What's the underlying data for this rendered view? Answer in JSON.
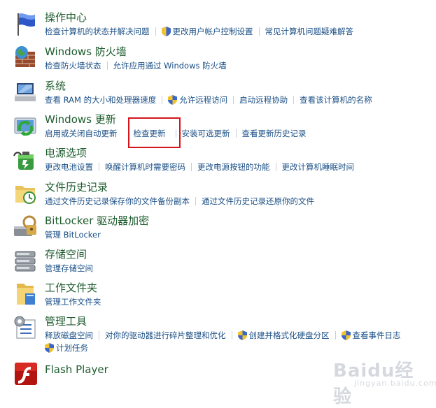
{
  "items": [
    {
      "title": "操作中心",
      "links": [
        {
          "label": "检查计算机的状态并解决问题",
          "shield": false
        },
        {
          "label": "更改用户帐户控制设置",
          "shield": true
        },
        {
          "label": "常见计算机问题疑难解答",
          "shield": false
        }
      ]
    },
    {
      "title": "Windows 防火墙",
      "links": [
        {
          "label": "检查防火墙状态",
          "shield": false
        },
        {
          "label": "允许应用通过 Windows 防火墙",
          "shield": false
        }
      ]
    },
    {
      "title": "系统",
      "links": [
        {
          "label": "查看 RAM 的大小和处理器速度",
          "shield": false
        },
        {
          "label": "允许远程访问",
          "shield": true
        },
        {
          "label": "启动远程协助",
          "shield": false
        },
        {
          "label": "查看该计算机的名称",
          "shield": false
        }
      ]
    },
    {
      "title": "Windows 更新",
      "links": [
        {
          "label": "启用或关闭自动更新",
          "shield": false
        },
        {
          "label": "检查更新",
          "shield": false
        },
        {
          "label": "安装可选更新",
          "shield": false
        },
        {
          "label": "查看更新历史记录",
          "shield": false
        }
      ]
    },
    {
      "title": "电源选项",
      "links": [
        {
          "label": "更改电池设置",
          "shield": false
        },
        {
          "label": "唤醒计算机时需要密码",
          "shield": false
        },
        {
          "label": "更改电源按钮的功能",
          "shield": false
        },
        {
          "label": "更改计算机睡眠时间",
          "shield": false
        }
      ]
    },
    {
      "title": "文件历史记录",
      "links": [
        {
          "label": "通过文件历史记录保存你的文件备份副本",
          "shield": false
        },
        {
          "label": "通过文件历史记录还原你的文件",
          "shield": false
        }
      ]
    },
    {
      "title": "BitLocker 驱动器加密",
      "links": [
        {
          "label": "管理 BitLocker",
          "shield": true
        }
      ]
    },
    {
      "title": "存储空间",
      "links": [
        {
          "label": "管理存储空间",
          "shield": false
        }
      ]
    },
    {
      "title": "工作文件夹",
      "links": [
        {
          "label": "管理工作文件夹",
          "shield": false
        }
      ]
    },
    {
      "title": "管理工具",
      "links": [
        {
          "label": "释放磁盘空间",
          "shield": false
        },
        {
          "label": "对你的驱动器进行碎片整理和优化",
          "shield": false
        },
        {
          "label": "创建并格式化硬盘分区",
          "shield": true
        },
        {
          "label": "查看事件日志",
          "shield": true
        }
      ],
      "links_row2": [
        {
          "label": "计划任务",
          "shield": true
        }
      ]
    },
    {
      "title": "Flash Player",
      "links": []
    }
  ],
  "watermark": {
    "text": "Baidu经验",
    "sub": "jingyan.baidu.com"
  },
  "colors": {
    "title": "#1e5c2e",
    "link": "#1a4f86",
    "highlight_box": "#d4151c"
  },
  "icons": [
    "flag-icon",
    "firewall-icon",
    "system-icon",
    "windows-update-icon",
    "power-icon",
    "file-history-icon",
    "bitlocker-icon",
    "storage-spaces-icon",
    "work-folders-icon",
    "admin-tools-icon",
    "flash-player-icon"
  ]
}
